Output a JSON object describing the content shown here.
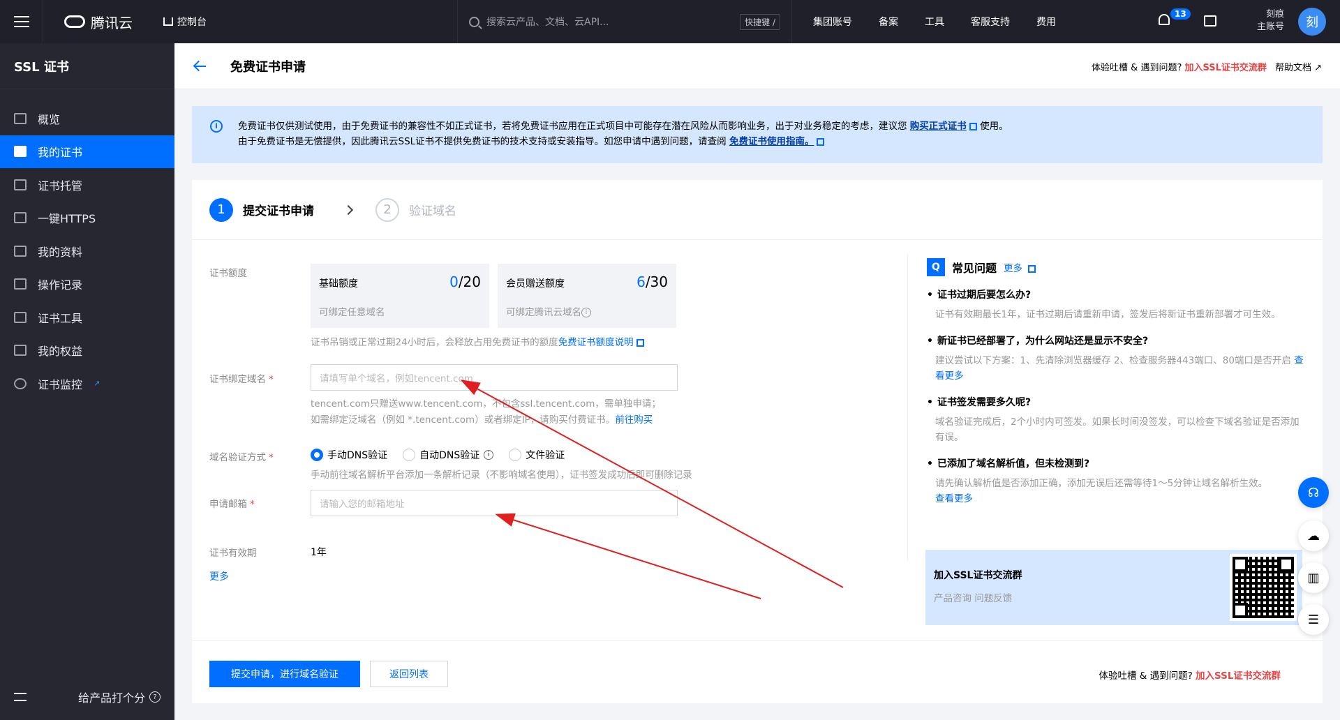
{
  "topbar": {
    "brand": "腾讯云",
    "console": "控制台",
    "search_placeholder": "搜索云产品、文档、云API...",
    "shortcut": "快捷键 /",
    "nav": [
      "集团账号",
      "备案",
      "工具",
      "客服支持",
      "费用"
    ],
    "notification_count": "13",
    "user_line1": "刻痕",
    "user_line2": "主账号",
    "avatar_char": "刻"
  },
  "sidebar": {
    "title": "SSL 证书",
    "items": [
      {
        "label": "概览"
      },
      {
        "label": "我的证书"
      },
      {
        "label": "证书托管"
      },
      {
        "label": "一键HTTPS"
      },
      {
        "label": "我的资料"
      },
      {
        "label": "操作记录"
      },
      {
        "label": "证书工具"
      },
      {
        "label": "我的权益"
      },
      {
        "label": "证书监控"
      }
    ],
    "rate_label": "给产品打个分"
  },
  "page": {
    "title": "免费证书申请",
    "feedback_text": "体验吐槽 & 遇到问题?",
    "join_group": "加入SSL证书交流群",
    "help_doc": "帮助文档"
  },
  "notice": {
    "line1_pre": "免费证书仅供测试使用，由于免费证书的兼容性不如正式证书，若将免费证书应用在正式项目中可能存在潜在风险从而影响业务，出于对业务稳定的考虑，建议您",
    "line1_link": "购买正式证书",
    "line1_post": "使用。",
    "line2_pre": "由于免费证书是无偿提供，因此腾讯云SSL证书不提供免费证书的技术支持或安装指导。如您申请中遇到问题，请查阅",
    "line2_link": "免费证书使用指南。"
  },
  "steps": [
    {
      "num": "1",
      "label": "提交证书申请"
    },
    {
      "num": "2",
      "label": "验证域名"
    }
  ],
  "form": {
    "quota_label": "证书额度",
    "quota_basic": {
      "title": "基础额度",
      "used": "0",
      "total": "/20",
      "sub": "可绑定任意域名"
    },
    "quota_member": {
      "title": "会员赠送额度",
      "used": "6",
      "total": "/30",
      "sub": "可绑定腾讯云域名"
    },
    "quota_hint_pre": "证书吊销或正常过期24小时后，会释放占用免费证书的额度",
    "quota_hint_link": "免费证书额度说明",
    "domain_label": "证书绑定域名",
    "domain_placeholder": "请填写单个域名，例如tencent.com",
    "domain_hint1": "tencent.com只赠送www.tencent.com，不包含ssl.tencent.com，需单独申请；",
    "domain_hint2_pre": "如需绑定泛域名（例如 *.tencent.com）或者绑定IP，请购买付费证书。",
    "domain_hint2_link": "前往购买",
    "verify_label": "域名验证方式",
    "verify_options": [
      "手动DNS验证",
      "自动DNS验证",
      "文件验证"
    ],
    "verify_hint": "手动前往域名解析平台添加一条解析记录（不影响域名使用），证书签发成功后即可删除记录",
    "email_label": "申请邮箱",
    "email_placeholder": "请输入您的邮箱地址",
    "validity_label": "证书有效期",
    "validity_value": "1年",
    "more": "更多"
  },
  "faq": {
    "title": "常见问题",
    "more": "更多",
    "items": [
      {
        "q": "证书过期后要怎么办?",
        "a": "证书有效期最长1年，证书过期后请重新申请，签发后将新证书重新部署才可生效。",
        "link": ""
      },
      {
        "q": "新证书已经部署了，为什么网站还是显示不安全?",
        "a": "建议尝试以下方案：1、先清除浏览器缓存 2、检查服务器443端口、80端口是否开启",
        "link": "查看更多"
      },
      {
        "q": "证书签发需要多久呢?",
        "a": "域名验证完成后，2个小时内可签发。如果长时间没签发，可以检查下域名验证是否添加有误。",
        "link": ""
      },
      {
        "q": "已添加了域名解析值，但未检测到?",
        "a": "请先确认解析值是否添加正确，添加无误后还需等待1～5分钟让域名解析生效。",
        "link": "查看更多"
      }
    ],
    "group_title": "加入SSL证书交流群",
    "group_sub": "产品咨询 问题反馈"
  },
  "footer": {
    "submit": "提交申请，进行域名验证",
    "back": "返回列表",
    "feedback_text": "体验吐槽 & 遇到问题?",
    "join_group": "加入SSL证书交流群"
  },
  "colors": {
    "primary": "#006eff",
    "danger": "#e54545",
    "annotation": "#e02020"
  }
}
